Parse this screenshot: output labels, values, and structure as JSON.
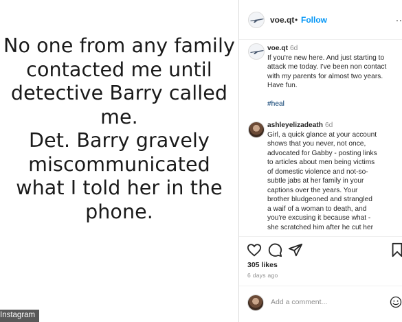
{
  "image_panel": {
    "quote_lines": [
      "No one from any family",
      "contacted me until",
      "detective Barry called",
      "me.",
      "Det. Barry gravely",
      "miscommunicated",
      "what I told her in the",
      "phone."
    ],
    "watermark": "Instagram"
  },
  "header": {
    "username": "voe.qt",
    "separator": "•",
    "follow_label": "Follow",
    "more_label": "..."
  },
  "caption": {
    "username": "voe.qt",
    "time": "6d",
    "lines": [
      "If you're new here. And just starting to",
      "attack me today. I've been non contact",
      "with my parents for almost two years.",
      "Have fun."
    ],
    "hashtag": "#heal"
  },
  "comment": {
    "username": "ashleyelizadeath",
    "time": "6d",
    "lines": [
      "Girl, a quick glance at your account",
      "shows that you never, not once,",
      "advocated for Gabby - posting links",
      "to articles about men being victims",
      "of domestic violence and not-so-",
      "subtle jabs at her family in your",
      "captions over the years. Your",
      "brother bludgeoned and strangled",
      "a waif of a woman to death, and",
      "you're excusing it because what -",
      "she scratched him after he cut her"
    ]
  },
  "actions": {
    "icons": [
      "heart-icon",
      "comment-icon",
      "share-icon",
      "bookmark-icon"
    ],
    "likes": "305 likes",
    "date": "6 days ago"
  },
  "add_comment": {
    "placeholder": "Add a comment..."
  },
  "colors": {
    "accent": "#0095f6",
    "hashtag": "#00376b",
    "muted": "#8e8e8e"
  }
}
